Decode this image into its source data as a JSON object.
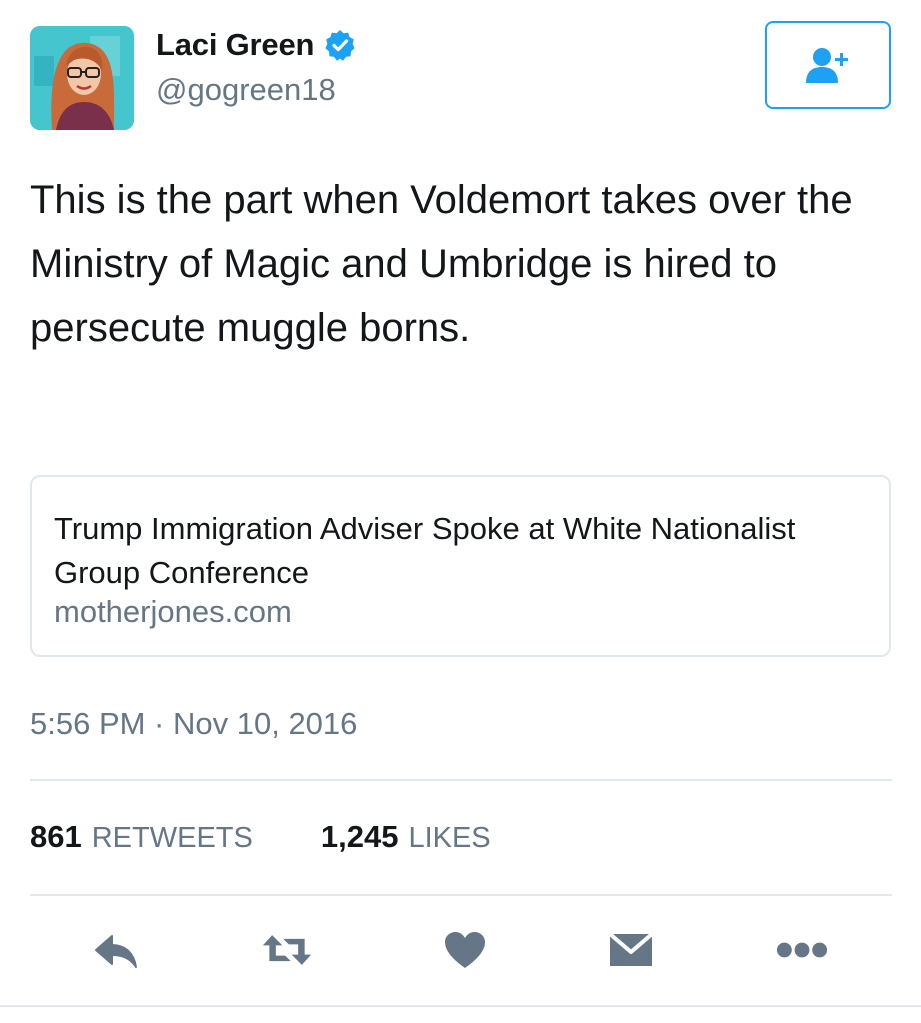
{
  "author": {
    "display_name": "Laci Green",
    "handle": "@gogreen18",
    "verified": true,
    "avatar_icon": "profile-photo"
  },
  "follow_button": {
    "icon": "add-user-icon",
    "color": "#1da1f2"
  },
  "tweet": {
    "text": "This is the part when Voldemort takes over the Ministry of Magic and Umbridge is hired to persecute muggle borns."
  },
  "link_card": {
    "title": "Trump Immigration Adviser Spoke at White Nationalist Group Conference",
    "domain": "motherjones.com"
  },
  "timestamp": "5:56 PM · Nov 10, 2016",
  "stats": {
    "retweets_count": "861",
    "retweets_label": "RETWEETS",
    "likes_count": "1,245",
    "likes_label": "LIKES"
  },
  "actions": [
    {
      "icon": "reply-icon"
    },
    {
      "icon": "retweet-icon"
    },
    {
      "icon": "heart-icon"
    },
    {
      "icon": "envelope-icon"
    },
    {
      "icon": "more-dots-icon"
    }
  ],
  "colors": {
    "accent": "#1da1f2",
    "text_primary": "#14171a",
    "text_secondary": "#657786",
    "icon_gray": "#657786",
    "divider": "#e1e8ed"
  }
}
